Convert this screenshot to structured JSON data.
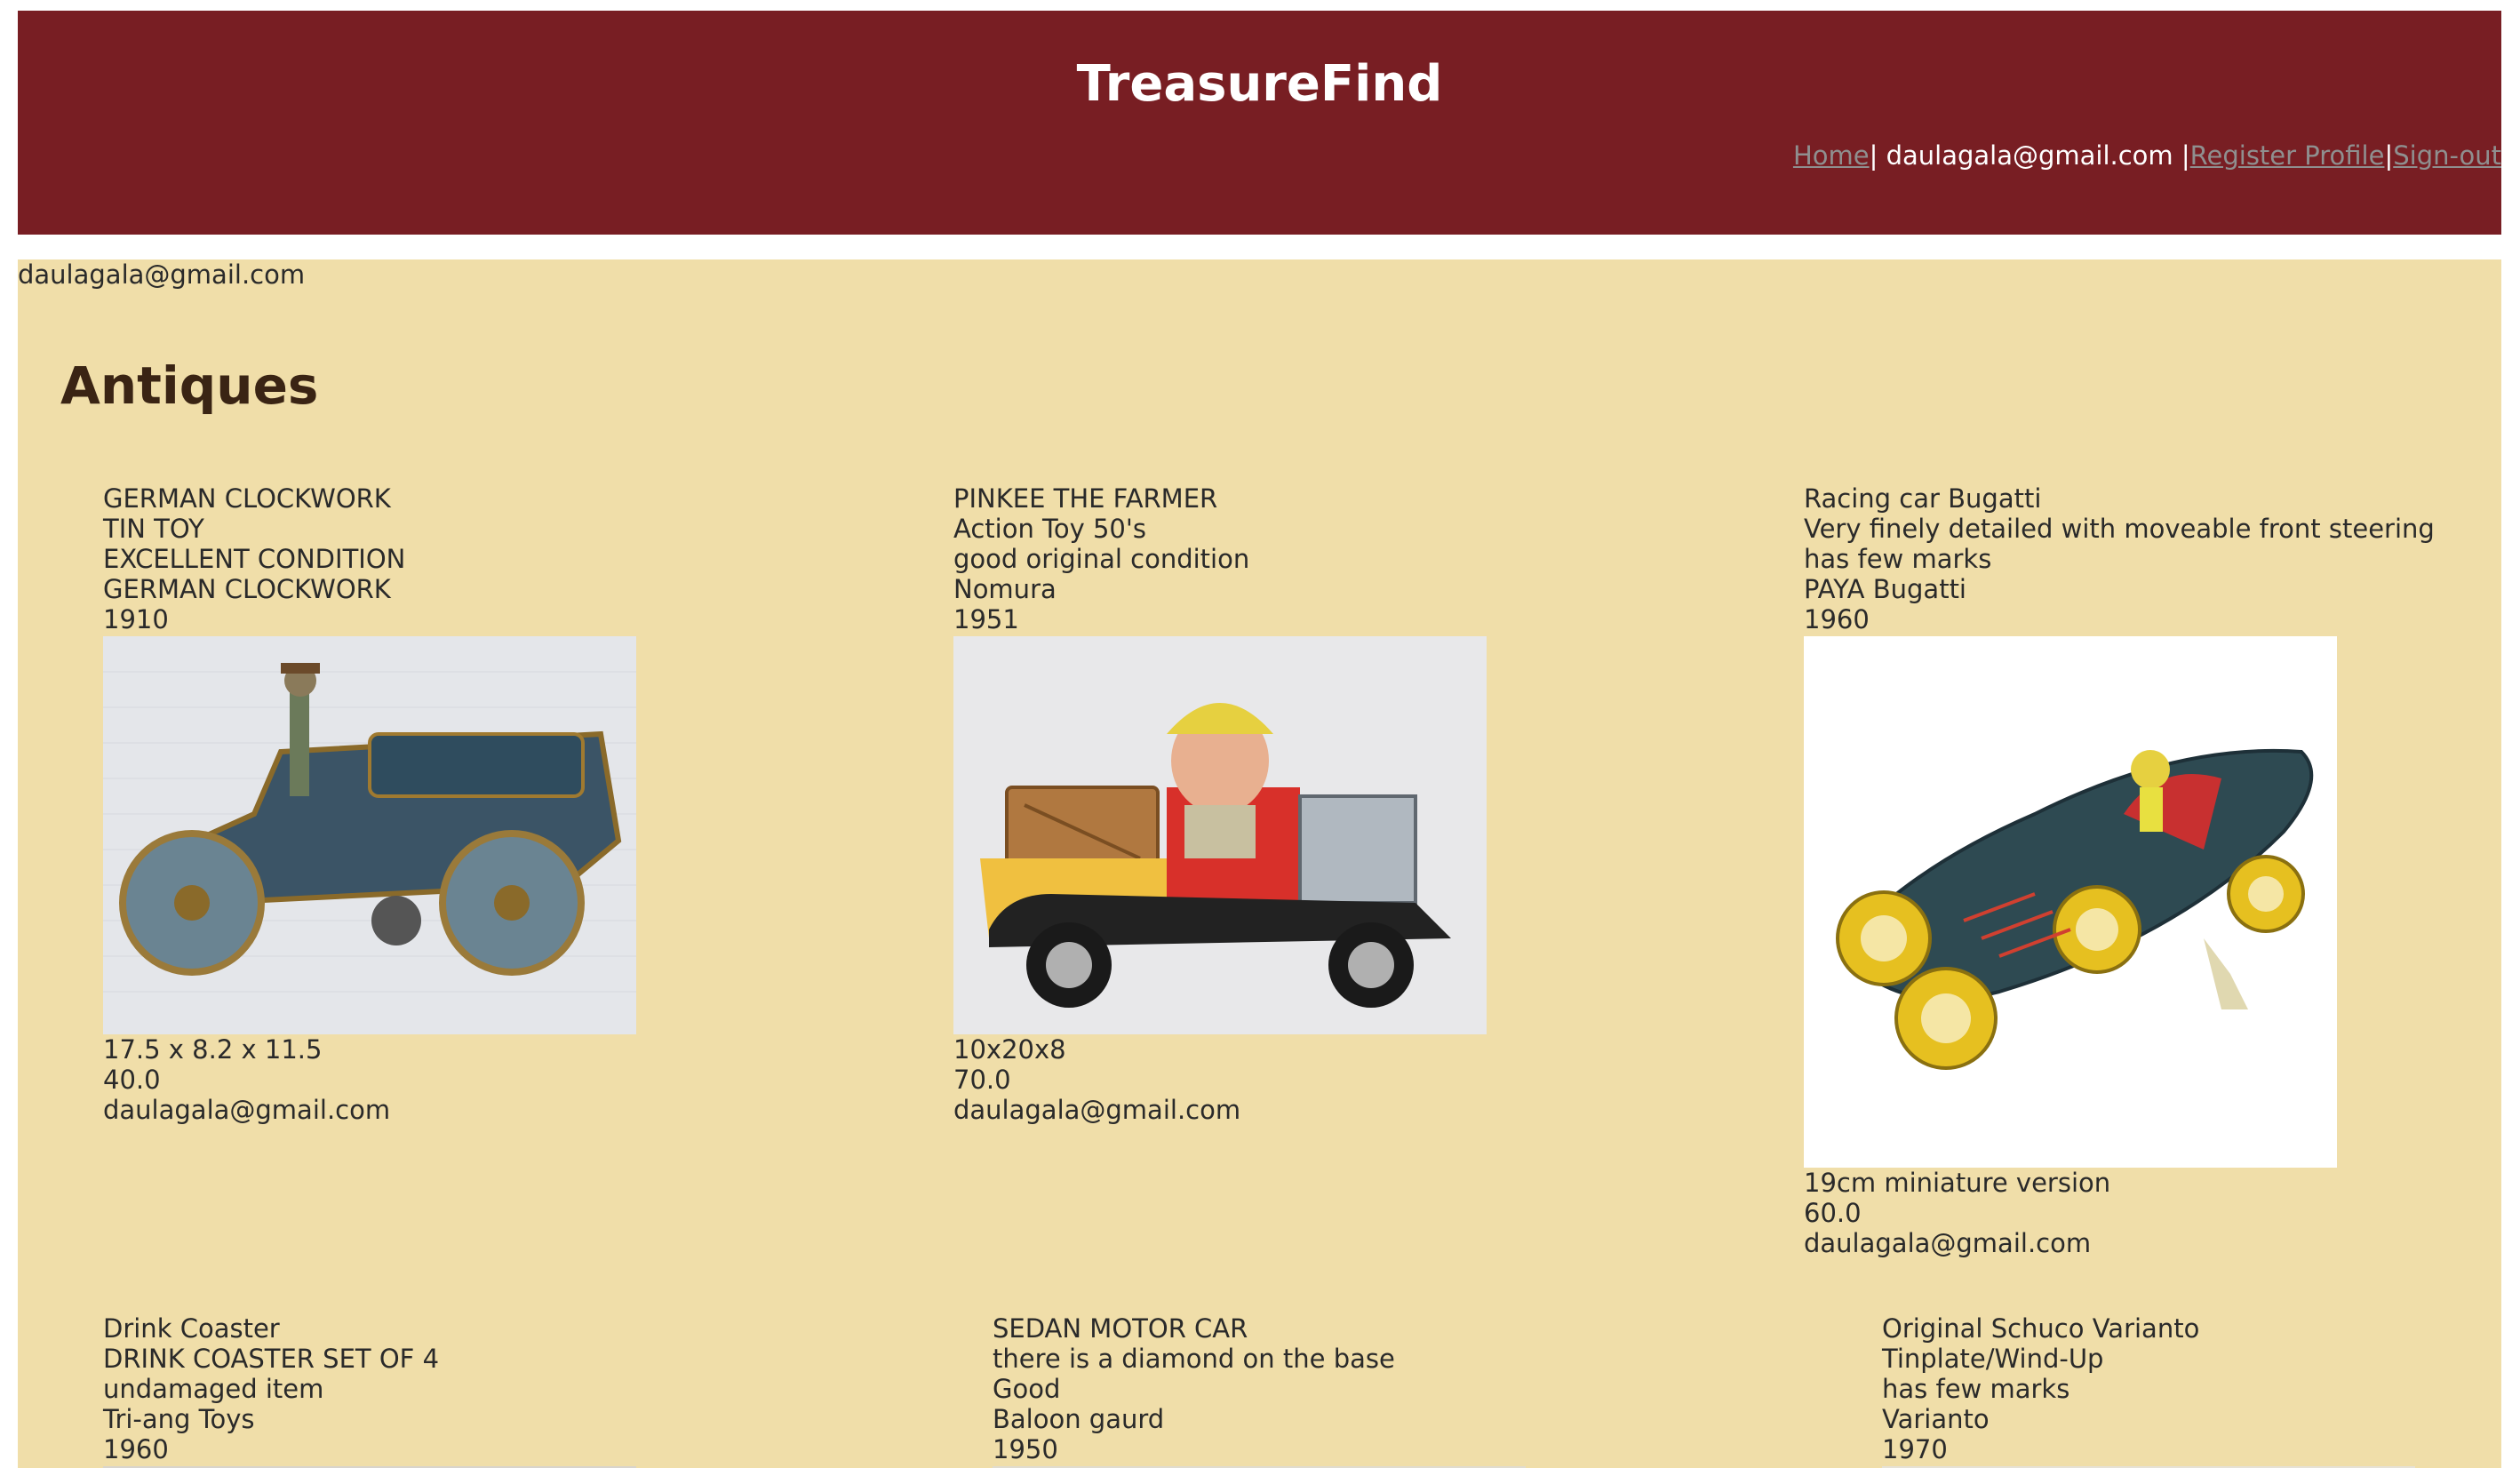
{
  "header": {
    "title": "TreasureFind",
    "nav": {
      "home": "Home",
      "user": "daulagala@gmail.com",
      "register": "Register Profile",
      "signout": "Sign-out"
    }
  },
  "main": {
    "user_email": "daulagala@gmail.com",
    "section_title": "Antiques",
    "items": [
      {
        "name": "GERMAN CLOCKWORK",
        "type": "TIN TOY",
        "condition": "EXCELLENT CONDITION",
        "maker": "GERMAN CLOCKWORK",
        "year": "1910",
        "size": "17.5 x 8.2 x 11.5",
        "price": "40.0",
        "seller": "daulagala@gmail.com"
      },
      {
        "name": "PINKEE THE FARMER",
        "type": "Action Toy 50's",
        "condition": "good original condition",
        "maker": "Nomura",
        "year": "1951",
        "size": "10x20x8",
        "price": "70.0",
        "seller": "daulagala@gmail.com"
      },
      {
        "name": "Racing car Bugatti",
        "type": "Very finely detailed with moveable front steering",
        "condition": "has few marks",
        "maker": "PAYA Bugatti",
        "year": "1960",
        "size": "19cm miniature version",
        "price": "60.0",
        "seller": "daulagala@gmail.com"
      },
      {
        "name": "Drink Coaster",
        "type": "DRINK COASTER SET OF 4",
        "condition": "undamaged item",
        "maker": "Tri-ang Toys",
        "year": "1960"
      },
      {
        "name": "SEDAN MOTOR CAR",
        "type": "there is a diamond on the base",
        "condition": "Good",
        "maker": "Baloon gaurd",
        "year": "1950"
      },
      {
        "name": "Original Schuco Varianto",
        "type": "Tinplate/Wind-Up",
        "condition": "has few marks",
        "maker": "Varianto",
        "year": "1970"
      }
    ]
  },
  "colors": {
    "header_bg": "#781e23",
    "content_bg": "#f0dea9",
    "link": "#8f8f8f"
  }
}
